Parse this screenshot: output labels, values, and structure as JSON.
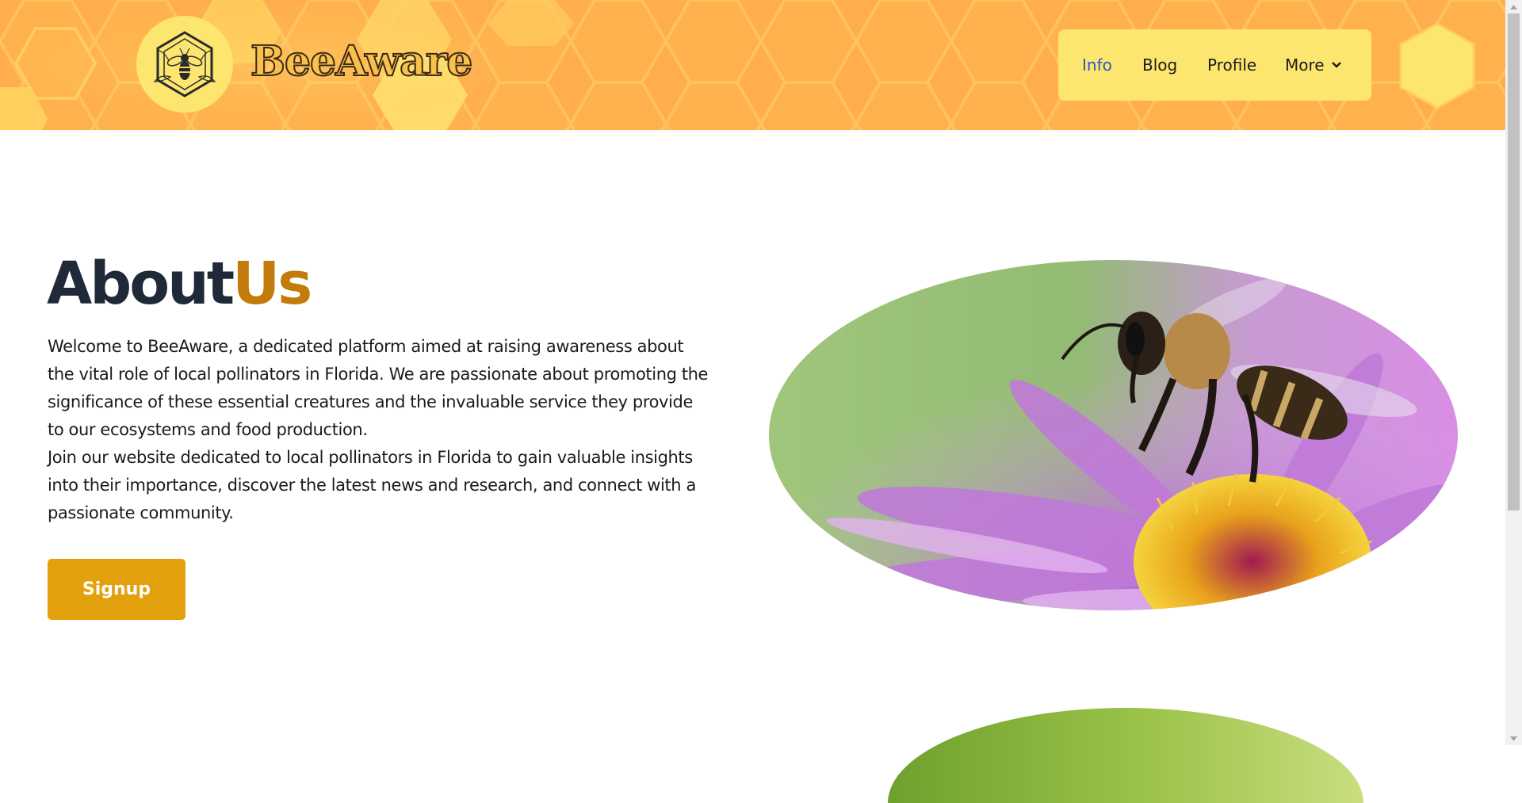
{
  "brand": {
    "name": "BeeAware",
    "logo_icon": "bee-hexagon-icon"
  },
  "nav": {
    "items": [
      {
        "label": "Info",
        "active": true
      },
      {
        "label": "Blog",
        "active": false
      },
      {
        "label": "Profile",
        "active": false
      },
      {
        "label": "More",
        "active": false,
        "icon": "chevron-down-icon"
      }
    ]
  },
  "about": {
    "title_part1": "About",
    "title_part2": "Us",
    "paragraph1": "Welcome to BeeAware, a dedicated platform aimed at raising awareness about the vital role of local pollinators in Florida. We are passionate about promoting the significance of these essential creatures and the invaluable service they provide to our ecosystems and food production.",
    "paragraph2": "Join our website dedicated to local pollinators in Florida to gain valuable insights into their importance, discover the latest news and research, and connect with a passionate community.",
    "signup_label": "Signup"
  },
  "colors": {
    "header_bg": "#ffad4f",
    "nav_bg": "#fde66f",
    "accent_gold": "#c37c0c",
    "button_bg": "#e2a10c",
    "title_dark": "#1f2937",
    "active_link": "#2f56c7"
  }
}
